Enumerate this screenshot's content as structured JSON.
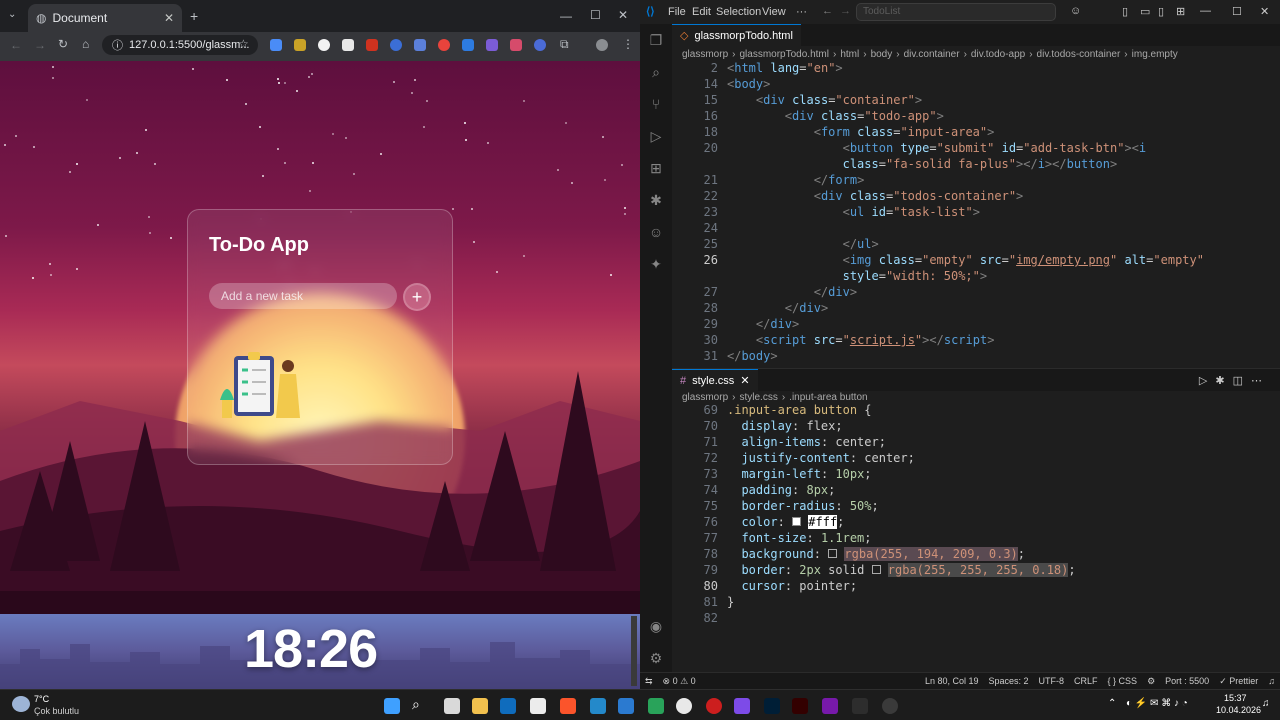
{
  "browser": {
    "tab_title": "Document",
    "url": "127.0.0.1:5500/glassm...",
    "app": {
      "title": "To-Do App",
      "input_placeholder": "Add a new task",
      "add_button": "+"
    },
    "wallpaper_clock": "18:26"
  },
  "vscode": {
    "search_text": "TodoList",
    "menu": [
      "File",
      "Edit",
      "Selection",
      "View"
    ],
    "html_tab": "glassmorpTodo.html",
    "html_breadcrumb": [
      "glassmorp",
      "glassmorpTodo.html",
      "html",
      "body",
      "div.container",
      "div.todo-app",
      "div.todos-container",
      "img.empty"
    ],
    "css_tab": "style.css",
    "css_breadcrumb": [
      "glassmorp",
      "style.css",
      ".input-area button"
    ],
    "html_lines": [
      {
        "n": "2",
        "html": "<span class='tg'>&lt;</span><span class='tn'>html</span> <span class='at'>lang</span>=<span class='sv'>\"en\"</span><span class='tg'>&gt;</span>"
      },
      {
        "n": "14",
        "html": "<span class='tg'>&lt;</span><span class='tn'>body</span><span class='tg'>&gt;</span>"
      },
      {
        "n": "15",
        "html": "    <span class='tg'>&lt;</span><span class='tn'>div</span> <span class='at'>class</span>=<span class='sv'>\"container\"</span><span class='tg'>&gt;</span>"
      },
      {
        "n": "16",
        "html": "        <span class='tg'>&lt;</span><span class='tn'>div</span> <span class='at'>class</span>=<span class='sv'>\"todo-app\"</span><span class='tg'>&gt;</span>"
      },
      {
        "n": "18",
        "html": "            <span class='tg'>&lt;</span><span class='tn'>form</span> <span class='at'>class</span>=<span class='sv'>\"input-area\"</span><span class='tg'>&gt;</span>"
      },
      {
        "n": "20",
        "html": "                <span class='tg'>&lt;</span><span class='tn'>button</span> <span class='at'>type</span>=<span class='sv'>\"submit\"</span> <span class='at'>id</span>=<span class='sv'>\"add-task-btn\"</span><span class='tg'>&gt;&lt;</span><span class='tn'>i</span>"
      },
      {
        "n": "",
        "html": "                <span class='at'>class</span>=<span class='sv'>\"fa-solid fa-plus\"</span><span class='tg'>&gt;&lt;/</span><span class='tn'>i</span><span class='tg'>&gt;&lt;/</span><span class='tn'>button</span><span class='tg'>&gt;</span>"
      },
      {
        "n": "21",
        "html": "            <span class='tg'>&lt;/</span><span class='tn'>form</span><span class='tg'>&gt;</span>"
      },
      {
        "n": "22",
        "html": "            <span class='tg'>&lt;</span><span class='tn'>div</span> <span class='at'>class</span>=<span class='sv'>\"todos-container\"</span><span class='tg'>&gt;</span>"
      },
      {
        "n": "23",
        "html": "                <span class='tg'>&lt;</span><span class='tn'>ul</span> <span class='at'>id</span>=<span class='sv'>\"task-list\"</span><span class='tg'>&gt;</span>"
      },
      {
        "n": "24",
        "html": ""
      },
      {
        "n": "25",
        "html": "                <span class='tg'>&lt;/</span><span class='tn'>ul</span><span class='tg'>&gt;</span>"
      },
      {
        "n": "26",
        "html": "                <span class='tg'>&lt;</span><span class='tn'>img</span> <span class='at'>class</span>=<span class='sv'>\"empty\"</span> <span class='at'>src</span>=<span class='sv'>\"<u>img/empty.png</u>\"</span> <span class='at'>alt</span>=<span class='sv'>\"empty\"</span>"
      },
      {
        "n": "",
        "html": "                <span class='at'>style</span>=<span class='sv'>\"width: 50%;\"</span><span class='tg'>&gt;</span>"
      },
      {
        "n": "27",
        "html": "            <span class='tg'>&lt;/</span><span class='tn'>div</span><span class='tg'>&gt;</span>"
      },
      {
        "n": "28",
        "html": "        <span class='tg'>&lt;/</span><span class='tn'>div</span><span class='tg'>&gt;</span>"
      },
      {
        "n": "29",
        "html": "    <span class='tg'>&lt;/</span><span class='tn'>div</span><span class='tg'>&gt;</span>"
      },
      {
        "n": "30",
        "html": "    <span class='tg'>&lt;</span><span class='tn'>script</span> <span class='at'>src</span>=<span class='sv'>\"<u>script.js</u>\"</span><span class='tg'>&gt;&lt;/</span><span class='tn'>script</span><span class='tg'>&gt;</span>"
      },
      {
        "n": "31",
        "html": "<span class='tg'>&lt;/</span><span class='tn'>body</span><span class='tg'>&gt;</span>"
      }
    ],
    "css_lines": [
      {
        "n": "69",
        "html": "<span class='sl'>.input-area button</span> {"
      },
      {
        "n": "70",
        "html": "  <span class='pr'>display</span>: flex;"
      },
      {
        "n": "71",
        "html": "  <span class='pr'>align-items</span>: center;"
      },
      {
        "n": "72",
        "html": "  <span class='pr'>justify-content</span>: center;"
      },
      {
        "n": "73",
        "html": "  <span class='pr'>margin-left</span>: <span class='nm'>10px</span>;"
      },
      {
        "n": "74",
        "html": "  <span class='pr'>padding</span>: <span class='nm'>8px</span>;"
      },
      {
        "n": "75",
        "html": "  <span class='pr'>border-radius</span>: <span class='nm'>50%</span>;"
      },
      {
        "n": "76",
        "html": "  <span class='pr'>color</span>: <span style='display:inline-block;width:9px;height:9px;background:#fff;border:1px solid #888'></span> <span class='sv' style='background:#fff;color:#000'>#fff</span>;"
      },
      {
        "n": "77",
        "html": "  <span class='pr'>font-size</span>: <span class='nm'>1.1rem</span>;"
      },
      {
        "n": "78",
        "html": "  <span class='pr'>background</span>: <span style='display:inline-block;width:9px;height:9px;border:1px solid #aaa'></span> <span class='sv' style='background:#5a4a52'>rgba(255, 194, 209, 0.3)</span>;"
      },
      {
        "n": "79",
        "html": "  <span class='pr'>border</span>: <span class='nm'>2px</span> solid <span style='display:inline-block;width:9px;height:9px;border:1px solid #aaa'></span> <span class='sv' style='background:#4a4a4a'>rgba(255, 255, 255, 0.18)</span>;"
      },
      {
        "n": "80",
        "html": "  <span class='pr'>cursor</span>: pointer;"
      },
      {
        "n": "81",
        "html": "}"
      },
      {
        "n": "82",
        "html": ""
      }
    ],
    "status": {
      "problems": "⊗ 0 ⚠ 0",
      "position": "Ln 80, Col 19",
      "spaces": "Spaces: 2",
      "encoding": "UTF-8",
      "eol": "CRLF",
      "language": "{ } CSS",
      "port": "Port : 5500",
      "prettier": "✓ Prettier"
    }
  },
  "taskbar": {
    "weather_temp": "7°C",
    "weather_text": "Çok bulutlu",
    "time": "15:37",
    "date": "10.04.2026"
  },
  "colors": {
    "accent": "#0078d4"
  }
}
